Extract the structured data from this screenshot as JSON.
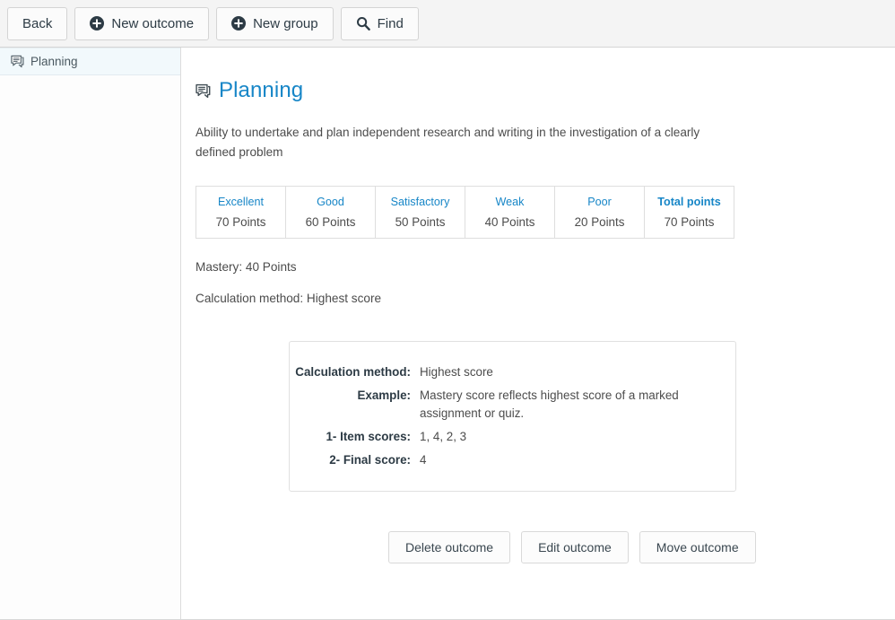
{
  "toolbar": {
    "buttons": [
      {
        "label": "Back",
        "icon": null
      },
      {
        "label": "New outcome",
        "icon": "plus-circle-icon"
      },
      {
        "label": "New group",
        "icon": "plus-circle-icon"
      },
      {
        "label": "Find",
        "icon": "search-icon"
      }
    ]
  },
  "sidebar": {
    "items": [
      {
        "label": "Planning",
        "icon": "outcome-icon",
        "selected": true
      }
    ]
  },
  "main": {
    "title": "Planning",
    "title_icon": "outcome-icon",
    "description": "Ability to undertake and plan independent research and writing in the investigation of a clearly defined problem",
    "ratings": {
      "headers": [
        "Excellent",
        "Good",
        "Satisfactory",
        "Weak",
        "Poor",
        "Total points"
      ],
      "values": [
        "70 Points",
        "60 Points",
        "50 Points",
        "40 Points",
        "20 Points",
        "70 Points"
      ]
    },
    "mastery": "Mastery: 40 Points",
    "calculation_method_line": "Calculation method: Highest score",
    "calc_box": {
      "rows": [
        {
          "key": "Calculation method:",
          "value": "Highest score"
        },
        {
          "key": "Example:",
          "value": "Mastery score reflects highest score of a marked assignment or quiz."
        },
        {
          "key": "1- Item scores:",
          "value": "1, 4, 2, 3"
        },
        {
          "key": "2- Final score:",
          "value": "4"
        }
      ]
    },
    "actions": [
      {
        "label": "Delete outcome"
      },
      {
        "label": "Edit outcome"
      },
      {
        "label": "Move outcome"
      }
    ]
  },
  "colors": {
    "accent": "#1786c7",
    "toolbar_bg": "#f4f4f4",
    "selected_item_bg": "#f2f9fc",
    "text": "#4c4c4c"
  }
}
